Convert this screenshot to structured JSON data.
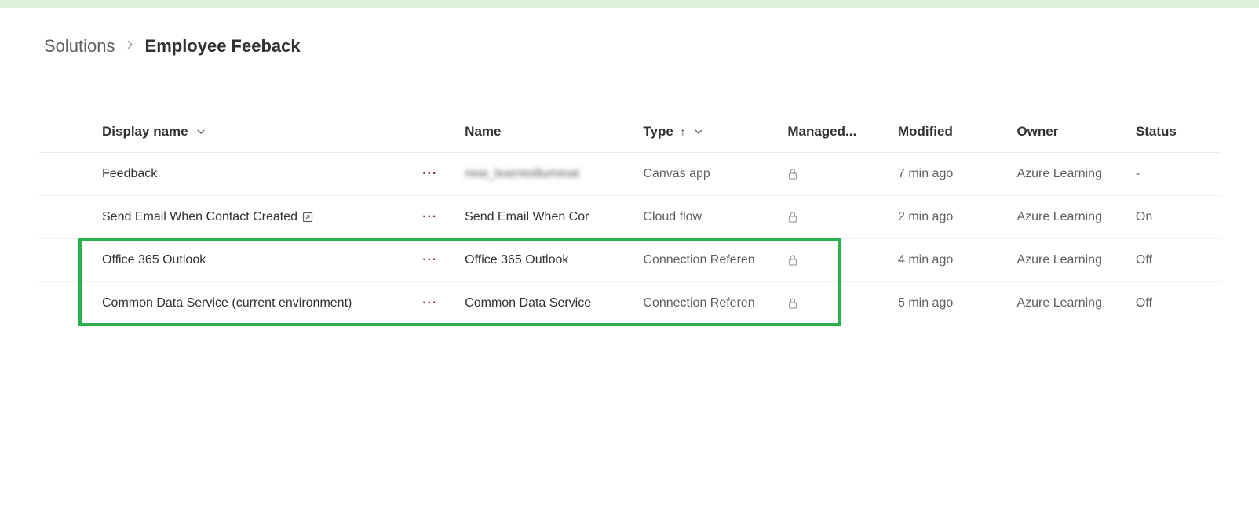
{
  "breadcrumb": {
    "root": "Solutions",
    "current": "Employee Feeback"
  },
  "columns": {
    "display": "Display name",
    "name": "Name",
    "type": "Type",
    "managed": "Managed...",
    "modified": "Modified",
    "owner": "Owner",
    "status": "Status"
  },
  "rows": [
    {
      "display": "Feedback",
      "has_open": false,
      "name": "new_learntoilluminat",
      "name_blurred": true,
      "type": "Canvas app",
      "managed_locked": true,
      "modified": "7 min ago",
      "owner": "Azure Learning",
      "status": "-"
    },
    {
      "display": "Send Email When Contact Created",
      "has_open": true,
      "name": "Send Email When Cor",
      "name_blurred": false,
      "type": "Cloud flow",
      "managed_locked": true,
      "modified": "2 min ago",
      "owner": "Azure Learning",
      "status": "On"
    },
    {
      "display": "Office 365 Outlook",
      "has_open": false,
      "name": "Office 365 Outlook",
      "name_blurred": false,
      "type": "Connection Referen",
      "managed_locked": true,
      "modified": "4 min ago",
      "owner": "Azure Learning",
      "status": "Off"
    },
    {
      "display": "Common Data Service (current environment)",
      "has_open": false,
      "name": "Common Data Service",
      "name_blurred": false,
      "type": "Connection Referen",
      "managed_locked": true,
      "modified": "5 min ago",
      "owner": "Azure Learning",
      "status": "Off"
    }
  ],
  "icons": {
    "more": "···"
  }
}
